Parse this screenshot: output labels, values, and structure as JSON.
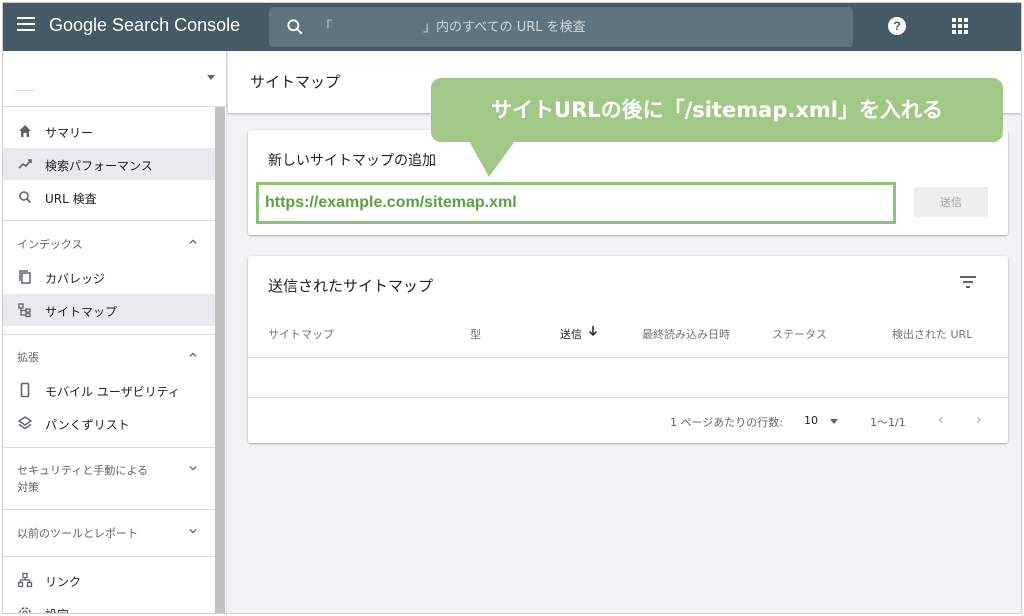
{
  "app": {
    "title": "Google Search Console"
  },
  "search": {
    "placeholder": "「　　　　　　　」内のすべての URL を検査"
  },
  "sidebar": {
    "top_items": [
      {
        "label": "サマリー",
        "icon": "home-icon"
      },
      {
        "label": "検索パフォーマンス",
        "icon": "trending-up-icon",
        "active": true
      },
      {
        "label": "URL 検査",
        "icon": "search-icon"
      }
    ],
    "index_section": {
      "heading": "インデックス",
      "items": [
        {
          "label": "カバレッジ",
          "icon": "copy-icon"
        },
        {
          "label": "サイトマップ",
          "icon": "sitemap-icon",
          "active": true
        }
      ]
    },
    "enhancements_section": {
      "heading": "拡張",
      "items": [
        {
          "label": "モバイル ユーザビリティ",
          "icon": "phone-icon"
        },
        {
          "label": "パンくずリスト",
          "icon": "layers-icon"
        }
      ]
    },
    "security_section": {
      "heading_line1": "セキュリティと手動による",
      "heading_line2": "対策"
    },
    "legacy_section": {
      "heading": "以前のツールとレポート"
    },
    "bottom_items": [
      {
        "label": "リンク",
        "icon": "links-icon"
      },
      {
        "label": "設定",
        "icon": "settings-icon"
      }
    ]
  },
  "page": {
    "title": "サイトマップ"
  },
  "add_sitemap": {
    "title": "新しいサイトマップの追加",
    "url_value": "https://example.com/sitemap.xml",
    "submit_label": "送信"
  },
  "submitted_sitemaps": {
    "title": "送信されたサイトマップ",
    "columns": [
      "サイトマップ",
      "型",
      "送信",
      "最終読み込み日時",
      "ステータス",
      "検出された URL"
    ],
    "sort_column": "送信",
    "rows_per_page_label": "1 ページあたりの行数:",
    "rows_per_page": "10",
    "range": "1〜1/1"
  },
  "callout": {
    "text": "サイトURLの後に「/sitemap.xml」を入れる"
  },
  "colors": {
    "topbar": "#455a64",
    "callout": "#a2c887",
    "url_text": "#5aa042",
    "url_border": "#8cc276"
  }
}
